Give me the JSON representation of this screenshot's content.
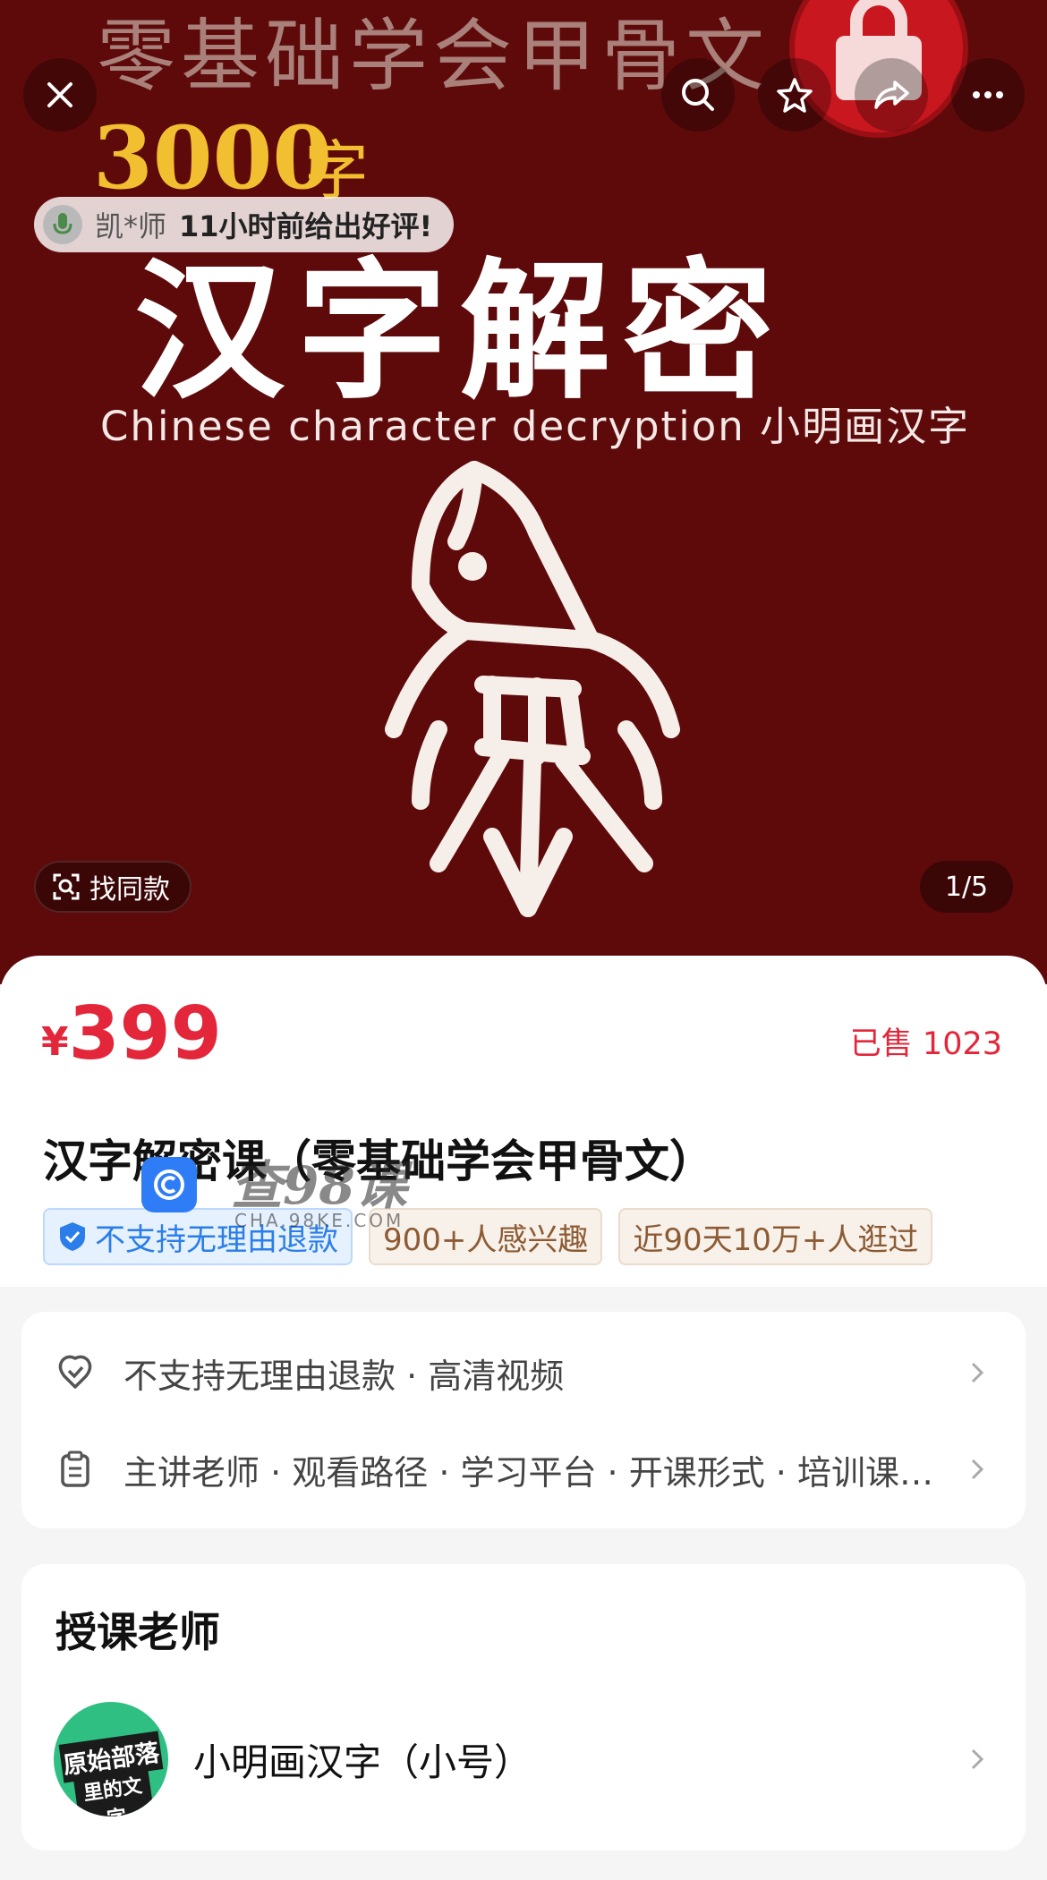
{
  "hero": {
    "top_title": "零基础学会甲骨文",
    "count": "3000",
    "count_unit": "字",
    "big_title": "汉字解密",
    "subtitle": "Chinese character decryption  小明画汉字",
    "review": {
      "name": "凯*师",
      "text": "11小时前给出好评!"
    },
    "find_same_label": "找同款",
    "pager": "1/5",
    "colors": {
      "background": "#5e0a0a",
      "gold": "#f1bf2f",
      "accent_red": "#c8171e"
    }
  },
  "toolbar": {
    "icons": [
      "close-icon",
      "search-icon",
      "star-icon",
      "share-icon",
      "more-icon"
    ]
  },
  "product": {
    "currency": "¥",
    "price": "399",
    "sold": "已售 1023",
    "title": "汉字解密课（零基础学会甲骨文）",
    "tags": [
      {
        "text": "不支持无理由退款",
        "style": "blue"
      },
      {
        "text": "900+人感兴趣",
        "style": "beige"
      },
      {
        "text": "近90天10万+人逛过",
        "style": "beige"
      }
    ],
    "colors": {
      "price": "#e4263a"
    }
  },
  "watermark": {
    "text": "查98课",
    "sub": "CHA.98KE.COM"
  },
  "services": [
    {
      "icon": "refund-shield-icon",
      "text": "不支持无理由退款 · 高清视频"
    },
    {
      "icon": "clipboard-icon",
      "text": "主讲老师 · 观看路径 · 学习平台 · 开课形式 · 培训课程类型"
    }
  ],
  "teacher": {
    "heading": "授课老师",
    "avatar_caption_1": "原始部落",
    "avatar_caption_2": "里的文字",
    "name": "小明画汉字（小号）"
  }
}
